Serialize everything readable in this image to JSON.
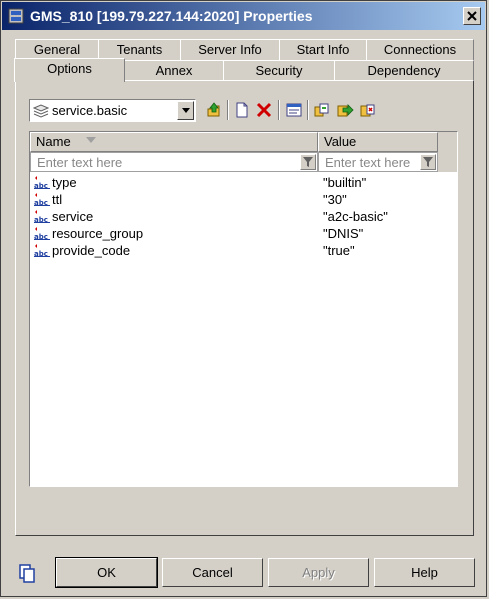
{
  "window": {
    "title": "GMS_810 [199.79.227.144:2020] Properties"
  },
  "tabs": {
    "row_back": [
      "General",
      "Tenants",
      "Server Info",
      "Start Info",
      "Connections"
    ],
    "row_front": [
      "Options",
      "Annex",
      "Security",
      "Dependency"
    ],
    "active": "Options"
  },
  "options": {
    "section_selected": "service.basic",
    "toolbar_icons": [
      "go-up-icon",
      "new-item-icon",
      "delete-icon",
      "properties-icon",
      "copy-icon",
      "move-icon",
      "paste-icon"
    ],
    "grid": {
      "columns": [
        "Name",
        "Value"
      ],
      "filter_placeholder": "Enter text here",
      "rows": [
        {
          "name": "type",
          "value": "\"builtin\""
        },
        {
          "name": "ttl",
          "value": "\"30\""
        },
        {
          "name": "service",
          "value": "\"a2c-basic\""
        },
        {
          "name": "resource_group",
          "value": "\"DNIS\""
        },
        {
          "name": "provide_code",
          "value": "\"true\""
        }
      ]
    }
  },
  "buttons": {
    "ok": "OK",
    "cancel": "Cancel",
    "apply": "Apply",
    "help": "Help"
  },
  "colors": {
    "title_start": "#0a246a",
    "title_end": "#a6caf0",
    "face": "#d4d0c8",
    "delete_red": "#d00000"
  }
}
